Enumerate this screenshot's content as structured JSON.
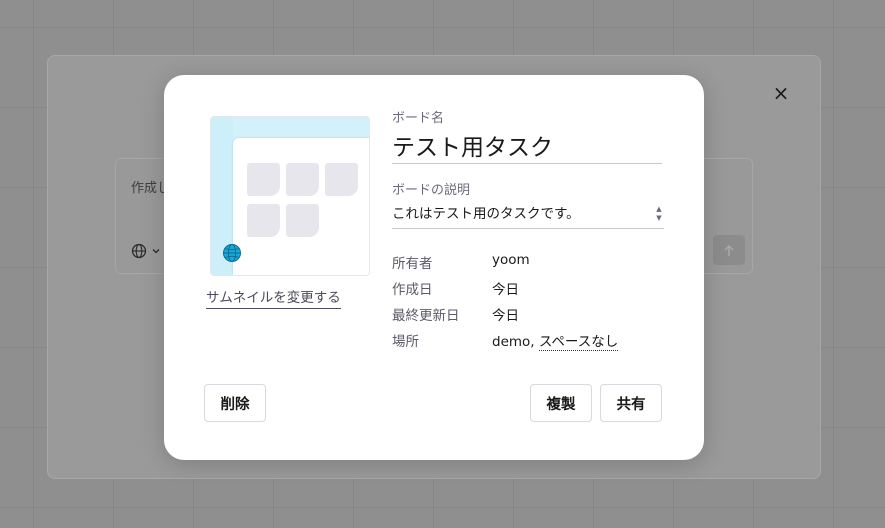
{
  "background": {
    "close_icon": "×",
    "card_label": "作成した",
    "language_icon": "globe-icon",
    "send_icon": "arrow-up-icon"
  },
  "modal": {
    "thumbnail": {
      "change_link": "サムネイルを変更する"
    },
    "board_name_label": "ボード名",
    "board_name_value": "テスト用タスク",
    "board_desc_label": "ボードの説明",
    "board_desc_value": "これはテスト用のタスクです。",
    "meta": {
      "owner_label": "所有者",
      "owner_value": "yoom",
      "created_label": "作成日",
      "created_value": "今日",
      "updated_label": "最終更新日",
      "updated_value": "今日",
      "location_label": "場所",
      "location_team": "demo,",
      "location_space": "スペースなし"
    },
    "buttons": {
      "delete": "削除",
      "duplicate": "複製",
      "share": "共有"
    }
  },
  "colors": {
    "accent_thumbnail": "#d2f1fb",
    "globe": "#1aa9d6",
    "overlay": "#8f8f8f"
  }
}
